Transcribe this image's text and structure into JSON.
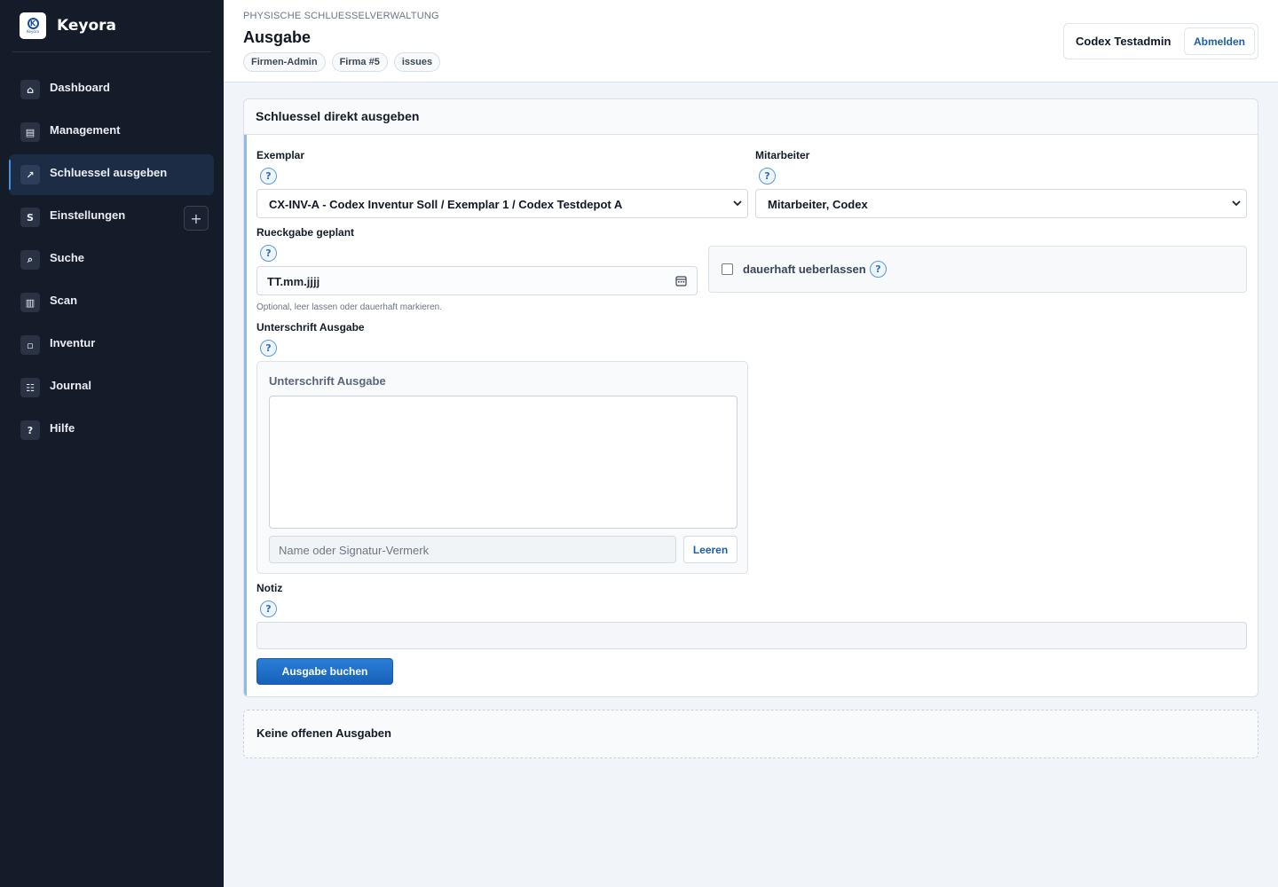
{
  "app": {
    "name": "Keyora",
    "logo_text": "Keyora"
  },
  "sidebar": {
    "items": [
      {
        "label": "Dashboard",
        "icon": "home-icon",
        "glyph": "⌂"
      },
      {
        "label": "Management",
        "icon": "building-icon",
        "glyph": "▤"
      },
      {
        "label": "Schluessel ausgeben",
        "icon": "arrow-up-right-icon",
        "glyph": "↗",
        "active": true
      },
      {
        "label": "Einstellungen",
        "icon": "settings-s-icon",
        "glyph": "S"
      },
      {
        "label": "Suche",
        "icon": "search-icon",
        "glyph": "⌕"
      },
      {
        "label": "Scan",
        "icon": "barcode-icon",
        "glyph": "▥"
      },
      {
        "label": "Inventur",
        "icon": "box-icon",
        "glyph": "▫"
      },
      {
        "label": "Journal",
        "icon": "list-icon",
        "glyph": "☷"
      },
      {
        "label": "Hilfe",
        "icon": "help-icon",
        "glyph": "?"
      }
    ],
    "expand_glyph": "+"
  },
  "header": {
    "kicker": "PHYSISCHE SCHLUESSELVERWALTUNG",
    "title": "Ausgabe",
    "chips": [
      "Firmen-Admin",
      "Firma #5",
      "issues"
    ],
    "user": "Codex Testadmin",
    "logout_label": "Abmelden"
  },
  "form": {
    "title": "Schluessel direkt ausgeben",
    "help_glyph": "?",
    "exemplar_label": "Exemplar",
    "exemplar_value": "CX-INV-A - Codex Inventur Soll / Exemplar 1 / Codex Testdepot A",
    "employee_label": "Mitarbeiter",
    "employee_value": "Mitarbeiter, Codex",
    "return_label": "Rueckgabe geplant",
    "return_placeholder": "TT.mm.jjjj",
    "return_hint": "Optional, leer lassen oder dauerhaft markieren.",
    "permanent_label": "dauerhaft ueberlassen",
    "permanent_checked": false,
    "signature_label": "Unterschrift Ausgabe",
    "signature_box_title": "Unterschrift Ausgabe",
    "signature_placeholder": "Name oder Signatur-Vermerk",
    "signature_clear_label": "Leeren",
    "note_label": "Notiz",
    "note_value": "",
    "submit_label": "Ausgabe buchen"
  },
  "open_issues": {
    "empty_text": "Keine offenen Ausgaben"
  },
  "colors": {
    "sidebar_bg": "#141b29",
    "accent": "#1762b8",
    "active_bg": "#1d2c45"
  }
}
